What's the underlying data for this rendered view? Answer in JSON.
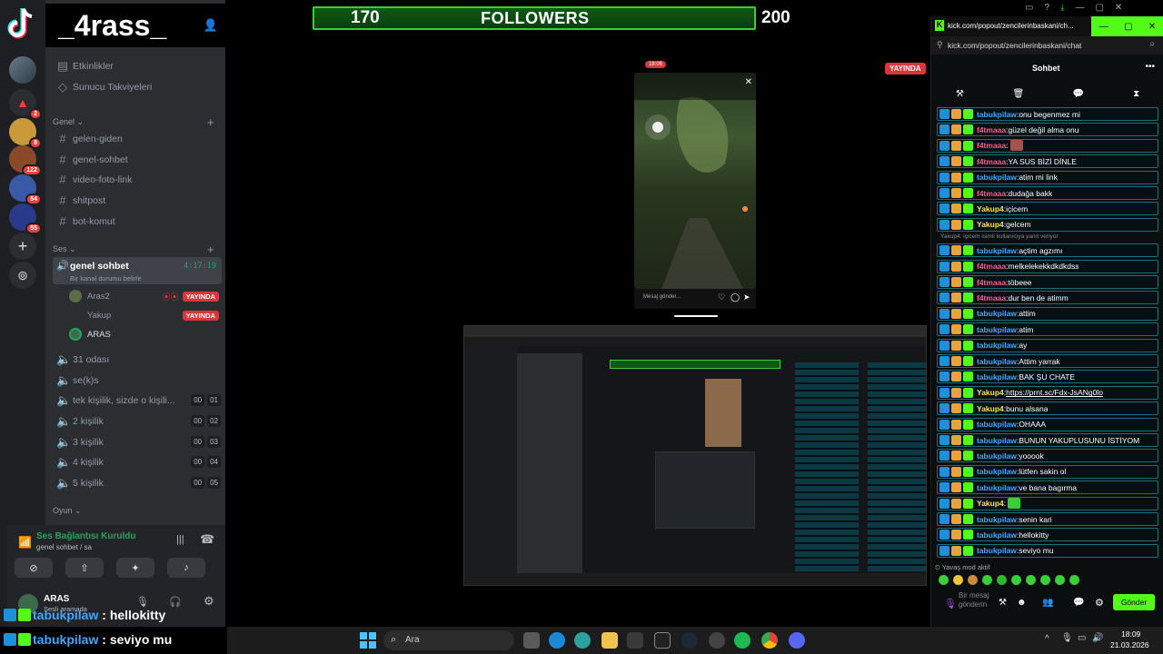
{
  "discord": {
    "server_name": "_4rass_",
    "server_badges": [
      "2",
      "8",
      "122",
      "54",
      "55"
    ],
    "menu": [
      "Etkinlikler",
      "Sunucu Takviyeleri"
    ],
    "text_category": "Genel",
    "text_channels": [
      "gelen-giden",
      "genel-sohbet",
      "video-foto-link",
      "shitpost",
      "bot-komut"
    ],
    "voice_category": "Ses",
    "active_voice": {
      "name": "genel sohbet",
      "timer": "4:17:19",
      "status": "Bir kanal durumu belirle"
    },
    "voice_users": [
      {
        "name": "Aras2",
        "live": "YAYINDA"
      },
      {
        "name": "Yakup",
        "live": "YAYINDA"
      },
      {
        "name": "ARAS",
        "live": ""
      }
    ],
    "voice_channels": [
      {
        "name": "31 odası",
        "a": "",
        "b": ""
      },
      {
        "name": "se(k)s",
        "a": "",
        "b": ""
      },
      {
        "name": "tek kişilik, sizde o kişili...",
        "a": "00",
        "b": "01"
      },
      {
        "name": "2 kişilik",
        "a": "00",
        "b": "02"
      },
      {
        "name": "3 kişilik",
        "a": "00",
        "b": "03"
      },
      {
        "name": "4 kişilik",
        "a": "00",
        "b": "04"
      },
      {
        "name": "5 kişilik",
        "a": "00",
        "b": "05"
      }
    ],
    "games_category": "Oyun",
    "connection": {
      "title": "Ses Bağlantısı Kuruldu",
      "sub": "genel sohbet / sa"
    },
    "user": {
      "name": "ARAS",
      "status": "Sesli aramada"
    }
  },
  "stream": {
    "followers_current": "170",
    "followers_label": "FOLLOWERS",
    "followers_goal": "200",
    "live_label": "YAYINDA",
    "phone_time": "18:06",
    "phone_msg_placeholder": "Mesaj gönder..."
  },
  "kick": {
    "window_title": "kick.com/popout/zencilerinbaskani/ch...",
    "url": "kick.com/popout/zencilerinbaskani/chat",
    "chat_title": "Sohbet",
    "reply_note": "Yakup4: içicem isimli kullanıcıya yanıt veriyor",
    "messages": [
      {
        "user": "tabukpilaw",
        "text": "onu begenmez mi",
        "color": "#3fa7ff"
      },
      {
        "user": "f4tmaaa",
        "text": "güzel değil alma onu",
        "color": "#ff5c8a"
      },
      {
        "user": "f4tmaaa",
        "text": "",
        "color": "#ff5c8a"
      },
      {
        "user": "f4tmaaa",
        "text": "YA SUS BİZİ DİNLE",
        "color": "#ff5c8a"
      },
      {
        "user": "tabukpilaw",
        "text": "atim mi link",
        "color": "#3fa7ff"
      },
      {
        "user": "f4tmaaa",
        "text": "dudağa bakk",
        "color": "#ff5c8a"
      },
      {
        "user": "Yakup4",
        "text": "içicem",
        "color": "#ffe14d"
      },
      {
        "user": "Yakup4",
        "text": "gelcem",
        "color": "#ffe14d"
      },
      {
        "user": "tabukpilaw",
        "text": "açtim agzımı",
        "color": "#3fa7ff"
      },
      {
        "user": "f4tmaaa",
        "text": "melkelekekkdkdkdss",
        "color": "#ff5c8a"
      },
      {
        "user": "f4tmaaa",
        "text": "töbeee",
        "color": "#ff5c8a"
      },
      {
        "user": "f4tmaaa",
        "text": "dur ben de atimm",
        "color": "#ff5c8a"
      },
      {
        "user": "tabukpilaw",
        "text": "attim",
        "color": "#3fa7ff"
      },
      {
        "user": "tabukpilaw",
        "text": "atim",
        "color": "#3fa7ff"
      },
      {
        "user": "tabukpilaw",
        "text": "ay",
        "color": "#3fa7ff"
      },
      {
        "user": "tabukpilaw",
        "text": "Attim yarrak",
        "color": "#3fa7ff"
      },
      {
        "user": "tabukpilaw",
        "text": "BAK ŞU CHATE",
        "color": "#3fa7ff"
      },
      {
        "user": "Yakup4",
        "text": "https://prnt.sc/Fdx-JsANg0lo",
        "color": "#ffe14d"
      },
      {
        "user": "Yakup4",
        "text": "bunu alsana",
        "color": "#ffe14d"
      },
      {
        "user": "tabukpilaw",
        "text": "OHAAA",
        "color": "#3fa7ff"
      },
      {
        "user": "tabukpilaw",
        "text": "BUNUN YAKUPLUSUNU İSTİYOM",
        "color": "#3fa7ff"
      },
      {
        "user": "tabukpilaw",
        "text": "yooook",
        "color": "#3fa7ff"
      },
      {
        "user": "tabukpilaw",
        "text": "lütfen sakin ol",
        "color": "#3fa7ff"
      },
      {
        "user": "tabukpilaw",
        "text": "ve bana bagırma",
        "color": "#3fa7ff"
      },
      {
        "user": "Yakup4",
        "text": "",
        "color": "#ffe14d"
      },
      {
        "user": "tabukpilaw",
        "text": "senin kari",
        "color": "#3fa7ff"
      },
      {
        "user": "tabukpilaw",
        "text": "hellokitty",
        "color": "#3fa7ff"
      },
      {
        "user": "tabukpilaw",
        "text": "seviyo mu",
        "color": "#3fa7ff"
      }
    ],
    "slow_mode": "Yavaş mod aktif",
    "input_placeholder": "Bir mesaj gönderin",
    "send_label": "Gönder"
  },
  "overlay": [
    {
      "user": "tabukpilaw",
      "text": "hellokitty"
    },
    {
      "user": "tabukpilaw",
      "text": "seviyo mu"
    }
  ],
  "taskbar": {
    "search": "Ara",
    "time": "18:09",
    "date": "21.03.2026"
  },
  "colors": {
    "kick_green": "#53fc18",
    "discord_live": "#da373c",
    "follow_bar": "#0c5a14"
  }
}
